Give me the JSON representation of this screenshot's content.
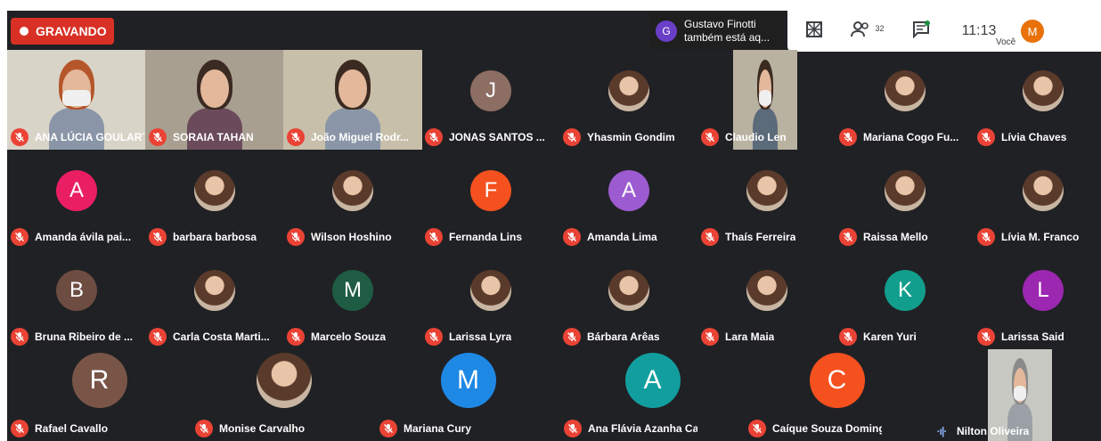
{
  "recording": {
    "label": "GRAVANDO"
  },
  "notice": {
    "initial": "G",
    "line1": "Gustavo Finotti",
    "line2": "também está aq..."
  },
  "toolbar": {
    "participants_count": "32",
    "time": "11:13",
    "you_initial": "M",
    "you_label": "Você"
  },
  "colors": {
    "recording": "#d93025",
    "muted": "#ea4335",
    "stage": "#202124"
  },
  "participants": [
    {
      "name": "ANA LÚCIA GOULART",
      "type": "video"
    },
    {
      "name": "SORAIA TAHAN",
      "type": "video"
    },
    {
      "name": "João Miguel Rodr...",
      "type": "video"
    },
    {
      "name": "JONAS SANTOS ...",
      "type": "initial",
      "initial": "J",
      "color": "#8d6e63"
    },
    {
      "name": "Yhasmin Gondim",
      "type": "photo"
    },
    {
      "name": "Claudio Len",
      "type": "video"
    },
    {
      "name": "Mariana Cogo Fu...",
      "type": "photo"
    },
    {
      "name": "Lívia Chaves",
      "type": "photo"
    },
    {
      "name": "Amanda ávila pai...",
      "type": "initial",
      "initial": "A",
      "color": "#e91e63"
    },
    {
      "name": "barbara barbosa",
      "type": "photo"
    },
    {
      "name": "Wilson Hoshino",
      "type": "photo"
    },
    {
      "name": "Fernanda Lins",
      "type": "initial",
      "initial": "F",
      "color": "#f4511e"
    },
    {
      "name": "Amanda Lima",
      "type": "initial",
      "initial": "A",
      "color": "#9c5bd1"
    },
    {
      "name": "Thaís Ferreira",
      "type": "photo"
    },
    {
      "name": "Raissa Mello",
      "type": "photo"
    },
    {
      "name": "Lívia M. Franco",
      "type": "photo"
    },
    {
      "name": "Bruna Ribeiro de ...",
      "type": "initial",
      "initial": "B",
      "color": "#6d4c41"
    },
    {
      "name": "Carla Costa Marti...",
      "type": "photo"
    },
    {
      "name": "Marcelo Souza",
      "type": "initial",
      "initial": "M",
      "color": "#1e5c44"
    },
    {
      "name": "Larissa Lyra",
      "type": "photo"
    },
    {
      "name": "Bárbara Arêas",
      "type": "photo"
    },
    {
      "name": "Lara Maia",
      "type": "photo"
    },
    {
      "name": "Karen Yuri",
      "type": "initial",
      "initial": "K",
      "color": "#129e8c"
    },
    {
      "name": "Larissa Said",
      "type": "initial",
      "initial": "L",
      "color": "#9c27b0"
    },
    {
      "name": "Rafael Cavallo",
      "type": "initial",
      "initial": "R",
      "color": "#795548"
    },
    {
      "name": "Monise Carvalho",
      "type": "photo"
    },
    {
      "name": "Mariana Cury",
      "type": "initial",
      "initial": "M",
      "color": "#1e88e5"
    },
    {
      "name": "Ana Flávia Azanha Camarg...",
      "type": "initial",
      "initial": "A",
      "color": "#129e9e"
    },
    {
      "name": "Caíque Souza Domingues",
      "type": "initial",
      "initial": "C",
      "color": "#f4511e"
    },
    {
      "name": "Nilton Oliveira",
      "type": "video",
      "speaking": true
    }
  ]
}
